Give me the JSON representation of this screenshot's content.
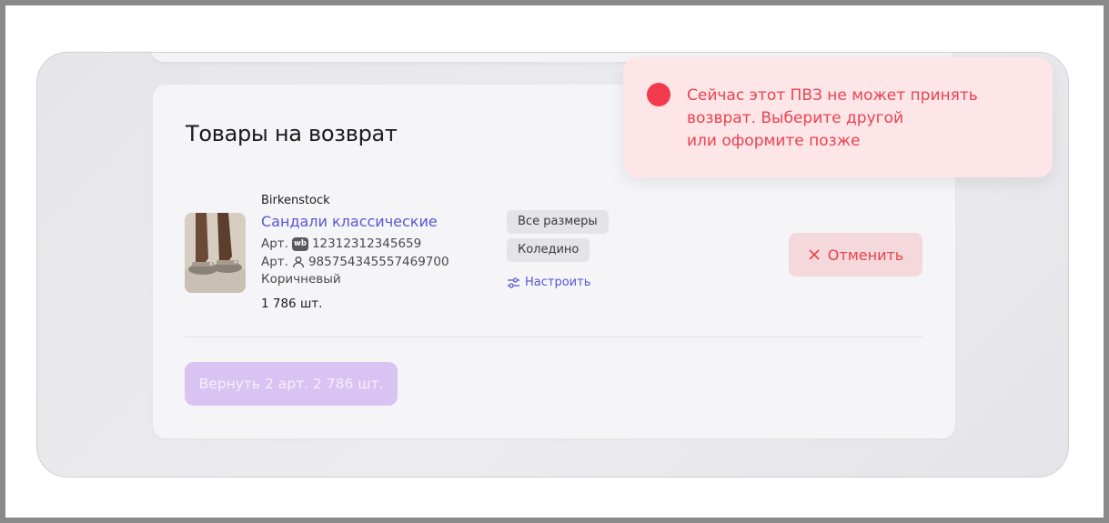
{
  "card": {
    "title": "Товары на возврат"
  },
  "product": {
    "brand": "Birkenstock",
    "name": "Сандали классические",
    "art_prefix": "Арт.",
    "wb_badge": "wb",
    "wb_article": "12312312345659",
    "seller_article": "985754345557469700",
    "color": "Коричневый",
    "quantity": "1 786 шт.",
    "image_icon": "sandals-photo"
  },
  "tags": {
    "sizes": "Все размеры",
    "warehouse": "Коледино"
  },
  "configure_label": "Настроить",
  "cancel_label": "Отменить",
  "return_label": "Вернуть 2 арт. 2 786 шт.",
  "toast": {
    "lines": [
      "Сейчас этот ПВЗ не может принять",
      "возврат. Выберите другой",
      "или оформите позже"
    ]
  },
  "colors": {
    "accent": "#5a55d6",
    "error": "#e8434f",
    "error_bg": "#fde5e8",
    "return_button_bg": "#d9c3f3"
  }
}
